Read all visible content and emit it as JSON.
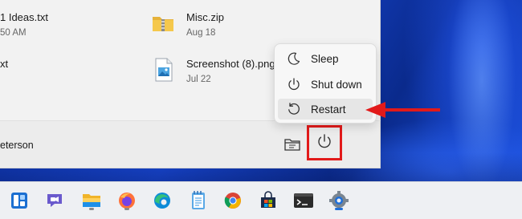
{
  "recent_files": [
    {
      "name": "1 Ideas.txt",
      "date": "50 AM",
      "icon": "text-file-icon"
    },
    {
      "name": "Misc.zip",
      "date": "Aug 18",
      "icon": "zip-folder-icon"
    },
    {
      "name": "xt",
      "date": "",
      "icon": "text-file-icon"
    },
    {
      "name": "Screenshot (8).png",
      "date": "Jul 22",
      "icon": "image-file-icon"
    }
  ],
  "user": {
    "name": "eterson"
  },
  "power_menu": {
    "items": [
      {
        "label": "Sleep",
        "icon": "moon-icon"
      },
      {
        "label": "Shut down",
        "icon": "power-icon"
      },
      {
        "label": "Restart",
        "icon": "restart-icon"
      }
    ]
  },
  "annotation": {
    "highlight_color": "#e21a1a"
  },
  "taskbar": {
    "icons": [
      "widgets-icon",
      "teams-chat-icon",
      "file-explorer-icon",
      "firefox-icon",
      "edge-icon",
      "notepad-icon",
      "chrome-icon",
      "store-icon",
      "terminal-icon",
      "settings-icon"
    ]
  }
}
